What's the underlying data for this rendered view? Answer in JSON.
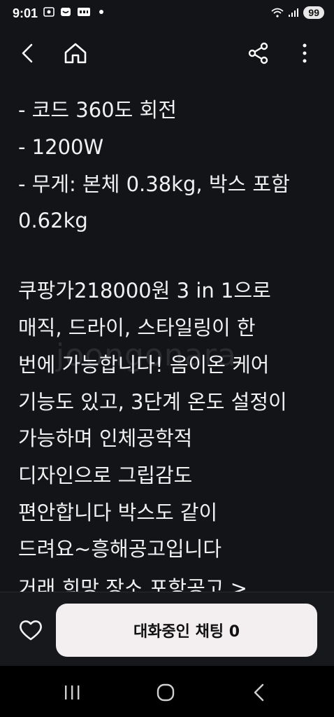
{
  "status_bar": {
    "time": "9:01",
    "battery": "99"
  },
  "content_lines": [
    "- 코드 360도 회전",
    "- 1200W",
    "- 무게: 본체 0.38kg, 박스 포함",
    "0.62kg",
    "",
    "쿠팡가218000원 3 in 1으로",
    "매직, 드라이, 스타일링이 한",
    "번에 가능합니다! 음이온 케어",
    "기능도 있고, 3단계 온도 설정이",
    "가능하며 인체공학적",
    "디자인으로 그립감도",
    "편안합니다 박스도 같이",
    "드려요~흥해공고입니다",
    "거래 희망 장소  포항공고 >"
  ],
  "watermark": "joongonara",
  "bottom": {
    "chat_button_label": "대화중인 채팅 0"
  },
  "colors": {
    "background": "#121418",
    "chat_button_bg": "#f3eff0"
  },
  "icons": {
    "back": "arrow-left-icon",
    "home": "home-icon",
    "share": "share-icon",
    "more": "more-vertical-icon",
    "like": "heart-outline-icon"
  }
}
